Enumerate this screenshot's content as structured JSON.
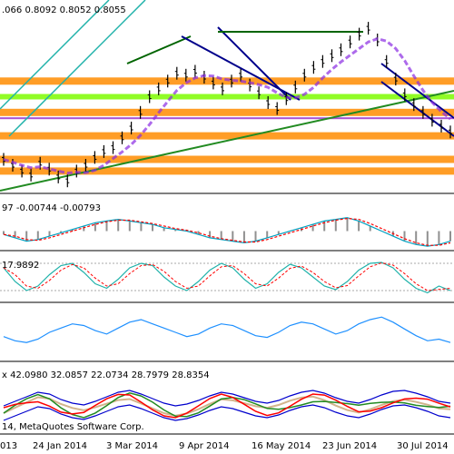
{
  "chart_data": {
    "type": "line",
    "symbol_timeframe": "",
    "main": {
      "ohlc_header": ".066 0.8092 0.8052 0.8055",
      "price_bars": [
        0.806,
        0.803,
        0.8,
        0.798,
        0.804,
        0.801,
        0.797,
        0.795,
        0.8,
        0.803,
        0.807,
        0.81,
        0.812,
        0.817,
        0.822,
        0.83,
        0.838,
        0.842,
        0.846,
        0.85,
        0.849,
        0.851,
        0.848,
        0.845,
        0.842,
        0.846,
        0.849,
        0.844,
        0.84,
        0.835,
        0.832,
        0.837,
        0.843,
        0.849,
        0.853,
        0.856,
        0.859,
        0.862,
        0.866,
        0.87,
        0.873,
        0.867,
        0.856,
        0.847,
        0.839,
        0.834,
        0.83,
        0.826,
        0.823,
        0.82
      ],
      "horizontal_levels": [
        {
          "price": 0.846,
          "color": "#ff8c00"
        },
        {
          "price": 0.838,
          "color": "#7cfc00"
        },
        {
          "price": 0.83,
          "color": "#ff8c00"
        },
        {
          "price": 0.827,
          "color": "#9932cc"
        },
        {
          "price": 0.818,
          "color": "#ff8c00"
        },
        {
          "price": 0.806,
          "color": "#ff8c00"
        },
        {
          "price": 0.8,
          "color": "#ff8c00"
        }
      ]
    },
    "macd": {
      "header": "97 -0.00744 -0.00793",
      "histogram": [
        -0.002,
        -0.004,
        -0.006,
        -0.005,
        -0.003,
        -0.001,
        0.001,
        0.003,
        0.005,
        0.006,
        0.007,
        0.006,
        0.005,
        0.004,
        0.002,
        0.001,
        0.0,
        -0.002,
        -0.004,
        -0.005,
        -0.006,
        -0.007,
        -0.006,
        -0.004,
        -0.002,
        0.0,
        0.002,
        0.004,
        0.006,
        0.007,
        0.008,
        0.006,
        0.003,
        0.0,
        -0.003,
        -0.006,
        -0.008,
        -0.009,
        -0.008,
        -0.006
      ],
      "signal_color": "#ff0000",
      "main_color": "#00a0c0"
    },
    "stochastic": {
      "header": "17.9892",
      "values": [
        70,
        40,
        20,
        30,
        55,
        75,
        80,
        60,
        35,
        25,
        45,
        70,
        80,
        75,
        50,
        30,
        20,
        40,
        65,
        80,
        70,
        45,
        25,
        35,
        60,
        78,
        70,
        50,
        30,
        22,
        40,
        65,
        80,
        82,
        70,
        45,
        25,
        15,
        30,
        20
      ],
      "levels": [
        80,
        20
      ]
    },
    "rsi": {
      "values": [
        45,
        40,
        38,
        42,
        50,
        55,
        60,
        58,
        52,
        48,
        55,
        62,
        65,
        60,
        55,
        50,
        45,
        48,
        55,
        60,
        58,
        52,
        46,
        44,
        50,
        58,
        62,
        60,
        54,
        48,
        52,
        60,
        65,
        68,
        62,
        54,
        46,
        40,
        42,
        38
      ]
    },
    "adx": {
      "header": "x 42.0980 32.0857 22.0734 28.7979 28.8354",
      "values": [
        25,
        30,
        35,
        40,
        38,
        32,
        28,
        26,
        30,
        35,
        40,
        42,
        38,
        33,
        28,
        25,
        27,
        31,
        36,
        40,
        38,
        34,
        30,
        28,
        31,
        36,
        40,
        42,
        39,
        34,
        30,
        28,
        32,
        37,
        41,
        42,
        39,
        35,
        30,
        28
      ]
    },
    "x_labels": [
      "013",
      "24 Jan 2014",
      "3 Mar 2014",
      "9 Apr 2014",
      "16 May 2014",
      "23 Jun 2014",
      "30 Jul 2014"
    ],
    "watermark": "14, MetaQuotes Software Corp."
  }
}
